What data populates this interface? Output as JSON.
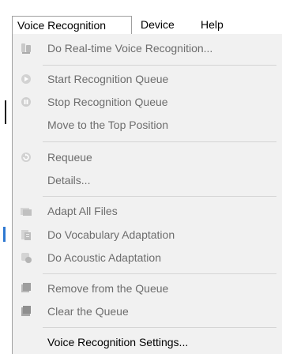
{
  "menubar": {
    "items": [
      "Voice Recognition",
      "Device",
      "Help"
    ]
  },
  "menu": {
    "items": [
      {
        "label": "Do Real-time Voice Recognition...",
        "icon": "realtime-voice-icon",
        "enabled": false
      },
      {
        "label": "Start Recognition Queue",
        "icon": "start-queue-icon",
        "enabled": false
      },
      {
        "label": "Stop Recognition Queue",
        "icon": "stop-queue-icon",
        "enabled": false
      },
      {
        "label": "Move to the Top Position",
        "icon": "",
        "enabled": false
      },
      {
        "label": "Requeue",
        "icon": "requeue-icon",
        "enabled": false
      },
      {
        "label": "Details...",
        "icon": "",
        "enabled": false
      },
      {
        "label": "Adapt All Files",
        "icon": "adapt-files-icon",
        "enabled": false
      },
      {
        "label": "Do Vocabulary Adaptation",
        "icon": "vocabulary-adaptation-icon",
        "enabled": false
      },
      {
        "label": "Do Acoustic Adaptation",
        "icon": "acoustic-adaptation-icon",
        "enabled": false
      },
      {
        "label": "Remove from the Queue",
        "icon": "remove-queue-icon",
        "enabled": false
      },
      {
        "label": "Clear the Queue",
        "icon": "clear-queue-icon",
        "enabled": false
      },
      {
        "label": "Voice Recognition Settings...",
        "icon": "",
        "enabled": true
      }
    ]
  }
}
